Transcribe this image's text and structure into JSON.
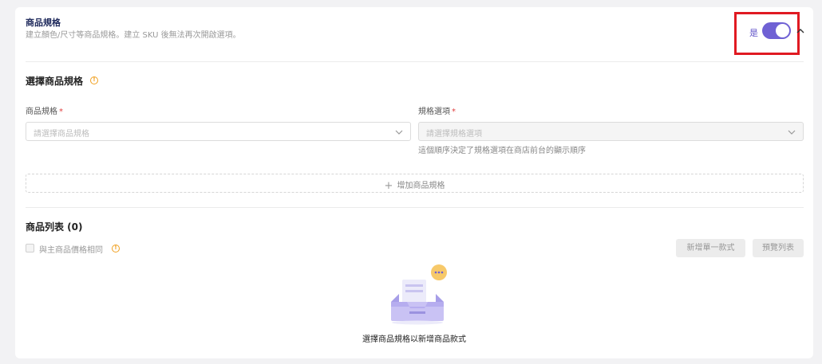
{
  "header": {
    "title": "商品規格",
    "description": "建立顏色/尺寸等商品規格。建立 SKU 後無法再次開啟選項。",
    "toggle_label": "是",
    "toggle_on": true
  },
  "spec_section": {
    "title": "選擇商品規格",
    "spec_field": {
      "label": "商品規格",
      "required_mark": "*",
      "placeholder": "請選擇商品規格"
    },
    "option_field": {
      "label": "規格選項",
      "required_mark": "*",
      "placeholder": "請選擇規格選項",
      "hint": "這個順序決定了規格選項在商店前台的顯示順序"
    },
    "add_button": "增加商品規格"
  },
  "product_list": {
    "title": "商品列表 (0)",
    "same_price_label": "與主商品價格相同",
    "add_single_button": "新增單一款式",
    "preview_button": "預覽列表",
    "empty_text": "選擇商品規格以新增商品款式"
  },
  "colors": {
    "accent": "#6f61d4",
    "highlight": "#e01a22",
    "info": "#f0a020"
  }
}
